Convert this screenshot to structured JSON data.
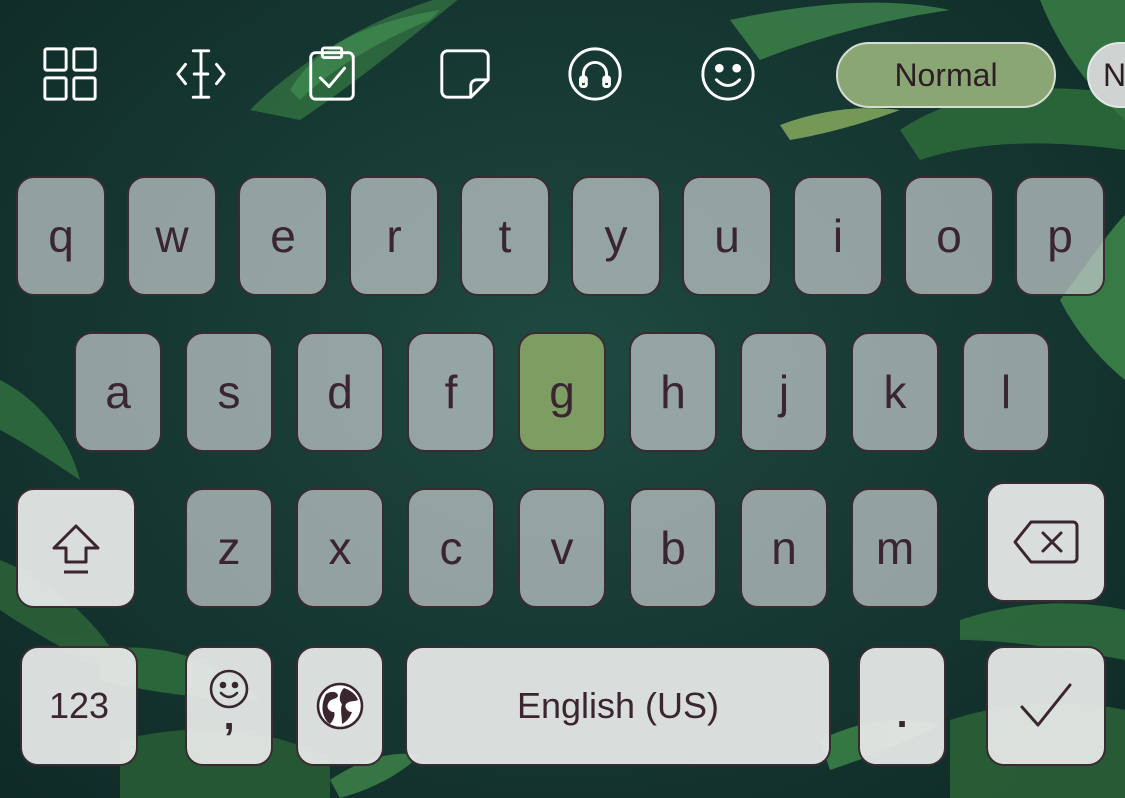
{
  "toolbar": {
    "icons": [
      "grid-icon",
      "text-cursor-icon",
      "clipboard-icon",
      "sticker-icon",
      "headphones-icon",
      "emoji-icon"
    ],
    "mode_label": "Normal",
    "next_mode_label": "N"
  },
  "keyboard": {
    "row1": [
      "q",
      "w",
      "e",
      "r",
      "t",
      "y",
      "u",
      "i",
      "o",
      "p"
    ],
    "row2": [
      "a",
      "s",
      "d",
      "f",
      "g",
      "h",
      "j",
      "k",
      "l"
    ],
    "row3": [
      "z",
      "x",
      "c",
      "v",
      "b",
      "n",
      "m"
    ],
    "highlighted_key": "g",
    "numbers_label": "123",
    "comma_label": ",",
    "space_label": "English (US)",
    "period_label": "."
  },
  "colors": {
    "background": "#173a34",
    "key_fill": "#c3cbcc",
    "key_highlight": "#7d9d63",
    "key_text": "#3a2530",
    "pill_active": "#8aa674"
  }
}
